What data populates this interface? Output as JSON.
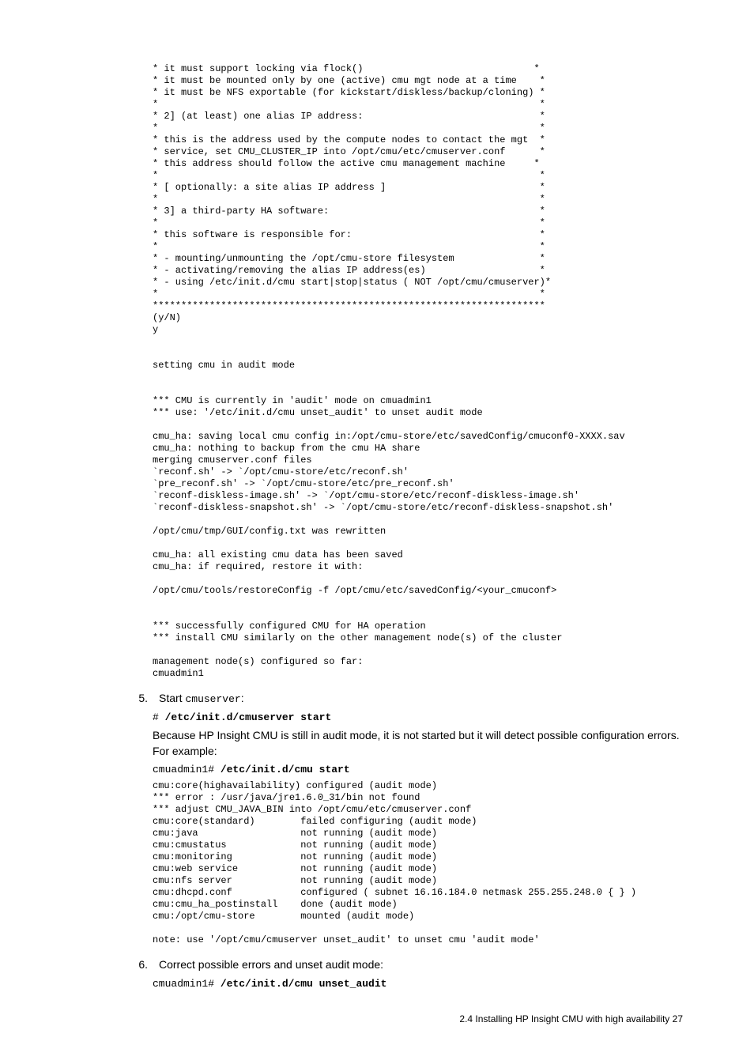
{
  "block1": "* it must support locking via flock()                              *\n* it must be mounted only by one (active) cmu mgt node at a time    *\n* it must be NFS exportable (for kickstart/diskless/backup/cloning) *\n*                                                                   *\n* 2] (at least) one alias IP address:                               *\n*                                                                   *\n* this is the address used by the compute nodes to contact the mgt  *\n* service, set CMU_CLUSTER_IP into /opt/cmu/etc/cmuserver.conf      *\n* this address should follow the active cmu management machine     *\n*                                                                   *\n* [ optionally: a site alias IP address ]                           *\n*                                                                   *\n* 3] a third-party HA software:                                     *\n*                                                                   *\n* this software is responsible for:                                 *\n*                                                                   *\n* - mounting/unmounting the /opt/cmu-store filesystem               *\n* - activating/removing the alias IP address(es)                    *\n* - using /etc/init.d/cmu start|stop|status ( NOT /opt/cmu/cmuserver)*\n*                                                                   *\n*********************************************************************\n(y/N)\ny\n\n\nsetting cmu in audit mode\n\n\n*** CMU is currently in 'audit' mode on cmuadmin1\n*** use: '/etc/init.d/cmu unset_audit' to unset audit mode\n\ncmu_ha: saving local cmu config in:/opt/cmu-store/etc/savedConfig/cmuconf0-XXXX.sav\ncmu_ha: nothing to backup from the cmu HA share\nmerging cmuserver.conf files\n`reconf.sh' -> `/opt/cmu-store/etc/reconf.sh'\n`pre_reconf.sh' -> `/opt/cmu-store/etc/pre_reconf.sh'\n`reconf-diskless-image.sh' -> `/opt/cmu-store/etc/reconf-diskless-image.sh'\n`reconf-diskless-snapshot.sh' -> `/opt/cmu-store/etc/reconf-diskless-snapshot.sh'\n\n/opt/cmu/tmp/GUI/config.txt was rewritten\n\ncmu_ha: all existing cmu data has been saved\ncmu_ha: if required, restore it with:\n\n/opt/cmu/tools/restoreConfig -f /opt/cmu/etc/savedConfig/<your_cmuconf>\n\n\n*** successfully configured CMU for HA operation\n*** install CMU similarly on the other management node(s) of the cluster\n\nmanagement node(s) configured so far:\ncmuadmin1",
  "step5": {
    "num": "5.",
    "text_prefix": "Start ",
    "text_mono": "cmuserver",
    "text_suffix": ":",
    "cmd_prompt": "# ",
    "cmd_bold": "/etc/init.d/cmuserver start",
    "para": "Because HP Insight CMU is still in audit mode, it is not started but it will detect possible configuration errors. For example:",
    "cmd2_prompt": "cmuadmin1# ",
    "cmd2_bold": "/etc/init.d/cmu start"
  },
  "block2": "cmu:core(highavailability) configured (audit mode)\n*** error : /usr/java/jre1.6.0_31/bin not found\n*** adjust CMU_JAVA_BIN into /opt/cmu/etc/cmuserver.conf\ncmu:core(standard)        failed configuring (audit mode)\ncmu:java                  not running (audit mode)\ncmu:cmustatus             not running (audit mode)\ncmu:monitoring            not running (audit mode)\ncmu:web service           not running (audit mode)\ncmu:nfs server            not running (audit mode)\ncmu:dhcpd.conf            configured ( subnet 16.16.184.0 netmask 255.255.248.0 { } )\ncmu:cmu_ha_postinstall    done (audit mode)\ncmu:/opt/cmu-store        mounted (audit mode)\n\nnote: use '/opt/cmu/cmuserver unset_audit' to unset cmu 'audit mode'",
  "step6": {
    "num": "6.",
    "text": "Correct possible errors and unset audit mode:",
    "cmd_prompt": "cmuadmin1# ",
    "cmd_bold": "/etc/init.d/cmu unset_audit"
  },
  "footer": "2.4 Installing HP Insight CMU with high availability    27"
}
